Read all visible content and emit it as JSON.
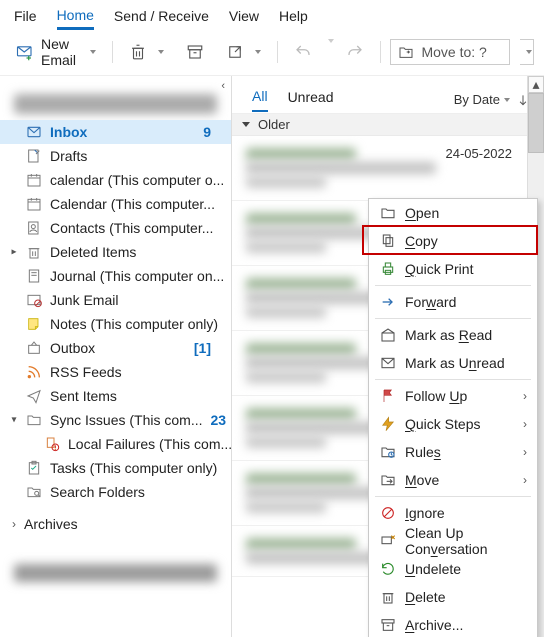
{
  "menubar": [
    {
      "id": "file",
      "label": "File"
    },
    {
      "id": "home",
      "label": "Home",
      "active": true
    },
    {
      "id": "sendrec",
      "label": "Send / Receive"
    },
    {
      "id": "view",
      "label": "View"
    },
    {
      "id": "help",
      "label": "Help"
    }
  ],
  "toolbar": {
    "new_email": "New Email",
    "move_to": "Move to: ?"
  },
  "folders": [
    {
      "id": "inbox",
      "label": "Inbox",
      "count": "9",
      "icon": "mail",
      "selected": true
    },
    {
      "id": "drafts",
      "label": "Drafts",
      "icon": "draft"
    },
    {
      "id": "cal1",
      "label": "calendar (This computer o...",
      "icon": "calendar"
    },
    {
      "id": "cal2",
      "label": "Calendar (This computer...",
      "icon": "calendar"
    },
    {
      "id": "contacts",
      "label": "Contacts (This computer...",
      "icon": "contacts"
    },
    {
      "id": "deleted",
      "label": "Deleted Items",
      "icon": "trash",
      "expandable": true,
      "open": false
    },
    {
      "id": "journal",
      "label": "Journal (This computer on...",
      "icon": "journal"
    },
    {
      "id": "junk",
      "label": "Junk Email",
      "icon": "junk"
    },
    {
      "id": "notes",
      "label": "Notes (This computer only)",
      "icon": "note"
    },
    {
      "id": "outbox",
      "label": "Outbox",
      "count": "[1]",
      "icon": "outbox"
    },
    {
      "id": "rss",
      "label": "RSS Feeds",
      "icon": "rss"
    },
    {
      "id": "sent",
      "label": "Sent Items",
      "icon": "sent"
    },
    {
      "id": "sync",
      "label": "Sync Issues (This com...",
      "count": "23",
      "icon": "sync",
      "expandable": true,
      "open": true
    },
    {
      "id": "localfail",
      "label": "Local Failures (This com...",
      "icon": "fail",
      "child": true
    },
    {
      "id": "tasks",
      "label": "Tasks (This computer only)",
      "icon": "tasks"
    },
    {
      "id": "search",
      "label": "Search Folders",
      "icon": "search"
    }
  ],
  "archives_label": "Archives",
  "filters": {
    "all": "All",
    "unread": "Unread",
    "sort": "By Date"
  },
  "group_older": "Older",
  "first_msg_date": "24-05-2022",
  "ctxmenu": [
    {
      "id": "open",
      "label": "Open",
      "ak": "O",
      "icon": "open"
    },
    {
      "id": "copy",
      "label": "Copy",
      "ak": "C",
      "icon": "copy"
    },
    {
      "id": "quickprint",
      "label": "Quick Print",
      "ak": "Q",
      "icon": "print"
    },
    {
      "id": "_sep"
    },
    {
      "id": "forward",
      "label": "Forward",
      "ak": "W",
      "icon": "forward"
    },
    {
      "id": "_sep"
    },
    {
      "id": "markread",
      "label": "Mark as Read",
      "ak": "R",
      "icon": "mailopen"
    },
    {
      "id": "markunread",
      "label": "Mark as Unread",
      "ak": "U",
      "icon": "mail"
    },
    {
      "id": "_sep"
    },
    {
      "id": "followup",
      "label": "Follow Up",
      "ak": "U",
      "icon": "flag",
      "sub": true
    },
    {
      "id": "quicksteps",
      "label": "Quick Steps",
      "ak": "Q",
      "icon": "quick",
      "sub": true
    },
    {
      "id": "rules",
      "label": "Rules",
      "ak": "s",
      "icon": "rules",
      "sub": true
    },
    {
      "id": "move",
      "label": "Move",
      "ak": "M",
      "icon": "move",
      "sub": true
    },
    {
      "id": "_sep"
    },
    {
      "id": "ignore",
      "label": "Ignore",
      "ak": "I",
      "icon": "ignore"
    },
    {
      "id": "cleanup",
      "label": "Clean Up Conversation",
      "ak": null,
      "icon": "broom"
    },
    {
      "id": "undelete",
      "label": "Undelete",
      "ak": "U",
      "icon": "undelete"
    },
    {
      "id": "delete",
      "label": "Delete",
      "ak": "D",
      "icon": "trash"
    },
    {
      "id": "archive",
      "label": "Archive...",
      "ak": "A",
      "icon": "archive"
    }
  ]
}
